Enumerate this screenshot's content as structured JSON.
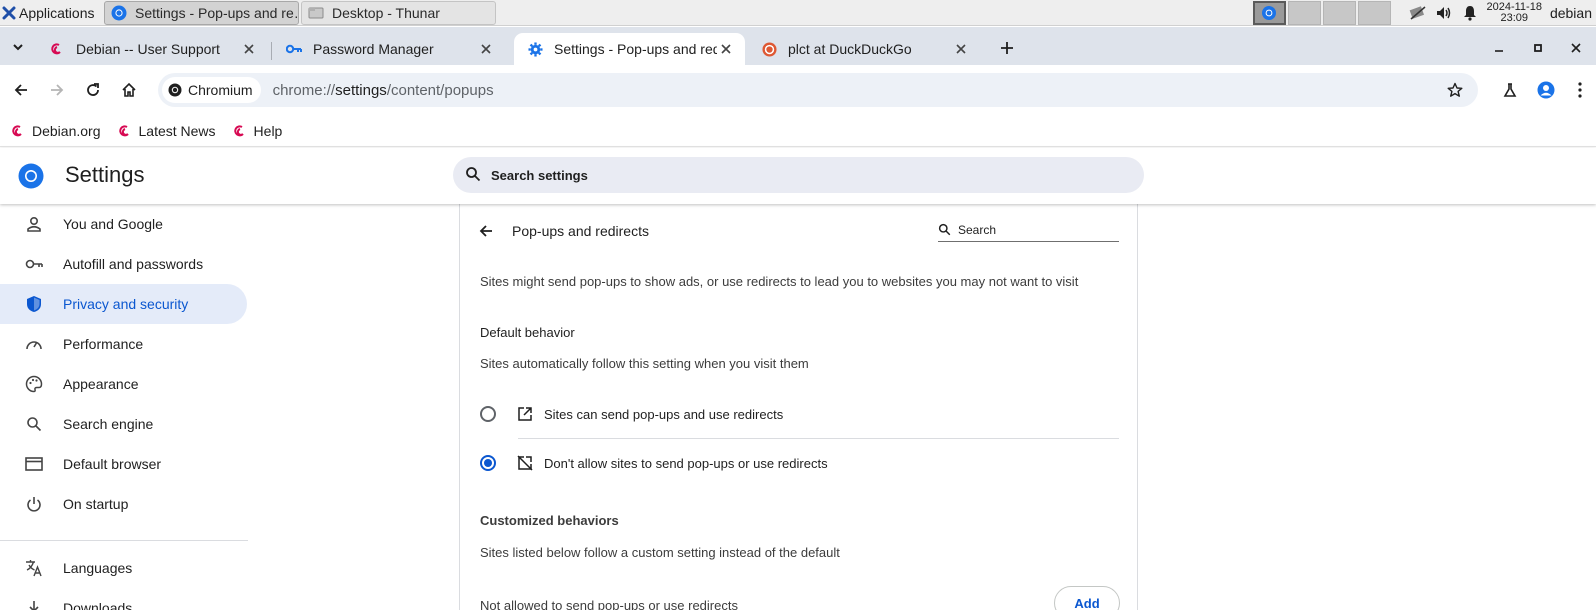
{
  "xfce_panel": {
    "applications_label": "Applications",
    "tasks": [
      {
        "label": "Settings - Pop-ups and re…",
        "icon": "chromium-icon",
        "active": true
      },
      {
        "label": "Desktop - Thunar",
        "icon": "folder-icon",
        "active": false
      }
    ],
    "clock_date": "2024-11-18",
    "clock_time": "23:09",
    "user": "debian"
  },
  "browser": {
    "tabs": [
      {
        "label": "Debian -- User Support",
        "icon": "debian-swirl-icon",
        "active": false
      },
      {
        "label": "Password Manager",
        "icon": "key-icon",
        "active": false
      },
      {
        "label": "Settings - Pop-ups and redirects",
        "icon": "gear-icon",
        "active": true
      },
      {
        "label": "plct at DuckDuckGo",
        "icon": "duckduckgo-icon",
        "active": false
      }
    ],
    "site_chip": "Chromium",
    "url_scheme": "chrome://",
    "url_host": "settings",
    "url_path": "/content/popups",
    "bookmarks": [
      {
        "label": "Debian.org",
        "icon": "debian-swirl-icon"
      },
      {
        "label": "Latest News",
        "icon": "debian-swirl-icon"
      },
      {
        "label": "Help",
        "icon": "debian-swirl-icon"
      }
    ]
  },
  "settings": {
    "title": "Settings",
    "search_placeholder": "Search settings",
    "nav": [
      {
        "label": "You and Google",
        "icon": "person-icon",
        "active": false
      },
      {
        "label": "Autofill and passwords",
        "icon": "key-icon",
        "active": false
      },
      {
        "label": "Privacy and security",
        "icon": "shield-icon",
        "active": true
      },
      {
        "label": "Performance",
        "icon": "speedometer-icon",
        "active": false
      },
      {
        "label": "Appearance",
        "icon": "palette-icon",
        "active": false
      },
      {
        "label": "Search engine",
        "icon": "search-icon",
        "active": false
      },
      {
        "label": "Default browser",
        "icon": "browser-window-icon",
        "active": false
      },
      {
        "label": "On startup",
        "icon": "power-icon",
        "active": false
      },
      {
        "label": "Languages",
        "icon": "translate-icon",
        "active": false
      },
      {
        "label": "Downloads",
        "icon": "download-icon",
        "active": false
      }
    ],
    "page": {
      "title": "Pop-ups and redirects",
      "search_placeholder": "Search",
      "description": "Sites might send pop-ups to show ads, or use redirects to lead you to websites you may not want to visit",
      "default_heading": "Default behavior",
      "default_sub": "Sites automatically follow this setting when you visit them",
      "options": [
        {
          "label": "Sites can send pop-ups and use redirects",
          "icon": "open-in-new-icon",
          "checked": false
        },
        {
          "label": "Don't allow sites to send pop-ups or use redirects",
          "icon": "popup-blocked-icon",
          "checked": true
        }
      ],
      "custom_heading": "Customized behaviors",
      "custom_sub": "Sites listed below follow a custom setting instead of the default",
      "not_allowed_label": "Not allowed to send pop-ups or use redirects",
      "add_label": "Add"
    }
  },
  "colors": {
    "accent": "#0b57d0",
    "nav_active_bg": "#e4ebf9",
    "tabstrip_bg": "#dee3eb",
    "omnibox_bg": "#edf1f7",
    "debian_red": "#d70a53"
  }
}
